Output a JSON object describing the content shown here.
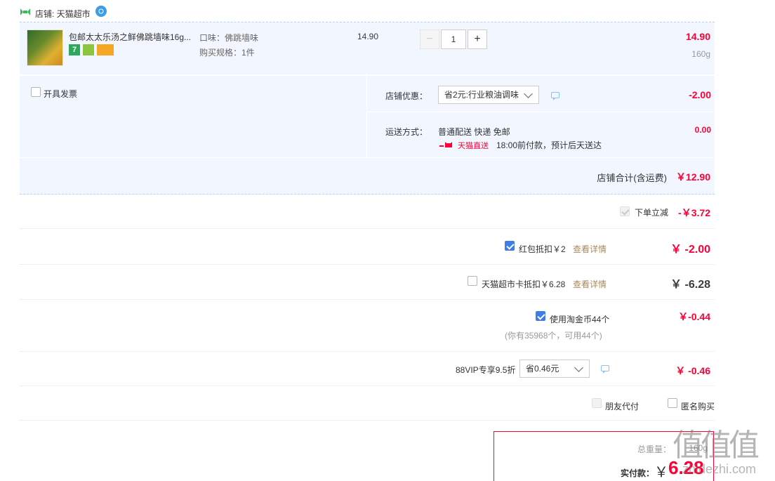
{
  "shop": {
    "label": "店铺: 天猫超市"
  },
  "item": {
    "title": "包邮太太乐汤之鲜佛跳墙味16g...",
    "flavor": "口味：佛跳墙味",
    "spec": "购买规格：1件",
    "unit_price": "14.90",
    "quantity": "1",
    "minus": "−",
    "plus": "+",
    "subtotal": "14.90",
    "weight": "160g"
  },
  "invoice": {
    "label": "开具发票"
  },
  "coupon": {
    "label": "店铺优惠：",
    "selected": "省2元:行业粮油调味",
    "amount": "-2.00"
  },
  "delivery": {
    "label": "运送方式：",
    "method": "普通配送 快递 免邮",
    "badge": "天猫直送",
    "note": "18:00前付款，预计后天送达",
    "amount": "0.00"
  },
  "shop_total": {
    "label": "店铺合计(含运费)",
    "amount": "￥12.90"
  },
  "instant_discount": {
    "label": "下单立减",
    "amount": "-￥3.72"
  },
  "red_packet": {
    "label": "红包抵扣￥2",
    "link": "查看详情",
    "amount": "￥ -2.00"
  },
  "tmall_card": {
    "label": "天猫超市卡抵扣￥6.28",
    "link": "查看详情",
    "amount": "￥ -6.28"
  },
  "gold_coin": {
    "label": "使用淘金币44个",
    "sub": "(你有35968个，可用44个)",
    "amount": "￥-0.44"
  },
  "vip": {
    "label": "88VIP专享9.5折",
    "selected": "省0.46元",
    "amount": "￥ -0.46"
  },
  "options": {
    "friend_pay": "朋友代付",
    "anonymous": "匿名购买"
  },
  "summary": {
    "weight_label": "总重量：",
    "weight": "160g",
    "pay_label": "实付款：",
    "currency": "￥",
    "pay_amount": "6.28"
  },
  "watermark": {
    "text": "值值值",
    "site": "zhidezhi.com"
  },
  "colors": {
    "accent_red": "#ff0036",
    "panel_bg": "#f2f7ff",
    "check_blue": "#3f7ee8",
    "border_blue": "#b2d1ff"
  }
}
